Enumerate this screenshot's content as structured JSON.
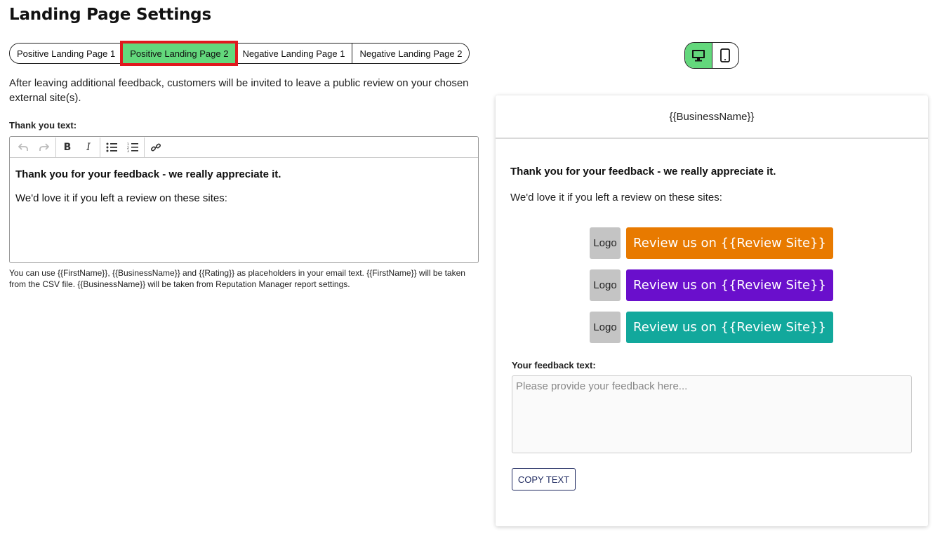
{
  "page_title": "Landing Page Settings",
  "tabs": [
    {
      "label": "Positive Landing Page 1",
      "active": false
    },
    {
      "label": "Positive Landing Page 2",
      "active": true
    },
    {
      "label": "Negative Landing Page 1",
      "active": false
    },
    {
      "label": "Negative Landing Page 2",
      "active": false
    }
  ],
  "intro_text": "After leaving additional feedback, customers will be invited to leave a public review on your chosen external site(s).",
  "thank_you_label": "Thank you text:",
  "toolbar": {
    "undo_icon": "undo-icon",
    "redo_icon": "redo-icon",
    "bold_label": "B",
    "italic_label": "I",
    "bullet_list_icon": "bullet-list-icon",
    "numbered_list_icon": "numbered-list-icon",
    "link_icon": "link-icon"
  },
  "editor": {
    "line1": "Thank you for your feedback - we really appreciate it.",
    "line2": "We'd love it if you left a review on these sites:"
  },
  "help_text": "You can use {{FirstName}}, {{BusinessName}} and {{Rating}} as placeholders in your email text. {{FirstName}} will be taken from the CSV file. {{BusinessName}} will be taken from Reputation Manager report settings.",
  "device_toggle": {
    "desktop_icon": "desktop-icon",
    "mobile_icon": "mobile-icon",
    "active": "desktop",
    "active_color": "#63d87c"
  },
  "preview": {
    "header": "{{BusinessName}}",
    "thanks": "Thank you for your feedback - we really appreciate it.",
    "love": "We'd love it if you left a review on these sites:",
    "review_buttons": [
      {
        "logo": "Logo",
        "label": "Review us on {{Review Site}}",
        "color": "#e87a00"
      },
      {
        "logo": "Logo",
        "label": "Review us on {{Review Site}}",
        "color": "#6a0fcc"
      },
      {
        "logo": "Logo",
        "label": "Review us on {{Review Site}}",
        "color": "#12a89c"
      }
    ],
    "feedback_label": "Your feedback text:",
    "feedback_placeholder": "Please provide your feedback here...",
    "copy_button": "COPY TEXT"
  },
  "colors": {
    "active_tab": "#63d87c",
    "highlight_outline": "#e0191e"
  }
}
